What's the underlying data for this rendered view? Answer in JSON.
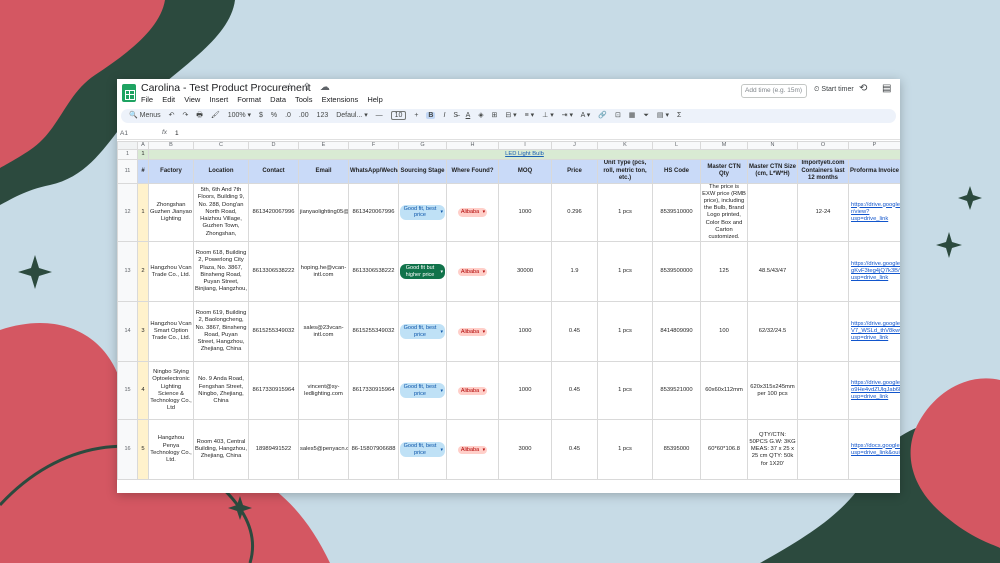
{
  "app": {
    "title": "Carolina - Test Product Procurement",
    "title_icons": "☆ ⇪ ☁",
    "menu": [
      "File",
      "Edit",
      "View",
      "Insert",
      "Format",
      "Data",
      "Tools",
      "Extensions",
      "Help"
    ],
    "time_placeholder": "Add time (e.g. 15m)",
    "start_timer": "⏲ Start timer"
  },
  "toolbar": {
    "menus_label": "🔍 Menus",
    "undo": "↶",
    "redo": "↷",
    "print": "🖶",
    "paint": "🖌",
    "zoom": "100% ▾",
    "currency": "$",
    "percent": "%",
    "dec_less": ".0",
    "dec_more": ".00",
    "num_format": "123",
    "font": "Defaul... ▾",
    "minus": "—",
    "font_size": "10",
    "plus": "+",
    "bold": "B",
    "italic": "I",
    "strike": "S̶",
    "text_color": "A",
    "fill": "◈",
    "borders": "⊞",
    "merge": "⊟ ▾",
    "align": "≡ ▾",
    "valign": "⊥ ▾",
    "wrap": "⇥ ▾",
    "rotate": "A ▾",
    "link": "🔗",
    "comment": "⊡",
    "chart": "▦",
    "filter": "⏷",
    "views": "▤ ▾",
    "functions": "Σ"
  },
  "formula": {
    "cell_ref": "A1",
    "fx": "fx",
    "value": "1"
  },
  "grid": {
    "columns": [
      "",
      "A",
      "B",
      "C",
      "D",
      "E",
      "F",
      "G",
      "H",
      "I",
      "J",
      "K",
      "L",
      "M",
      "N",
      "O",
      "P"
    ],
    "group_row": {
      "num": "1",
      "a": "1",
      "label": "LED Light Bulb"
    },
    "header": {
      "num": "11",
      "cells": [
        "#",
        "Factory",
        "Location",
        "Contact",
        "Email",
        "WhatsApp/Wechat",
        "Sourcing Stage",
        "Where Found?",
        "MOQ",
        "Price",
        "Unit Type (pcs, roll, metric ton, etc.)",
        "HS Code",
        "Master CTN Qty",
        "Master CTN Size (cm, L*W*H)",
        "Importyeti.com Containers last 12 months",
        "Proforma Invoice"
      ]
    },
    "rows": [
      {
        "num": "12",
        "id": "1",
        "factory": "Zhongshan Guzhen Jianyao Lighting",
        "location": "5th, 6th And 7th Floors, Building 9, No. 288, Dong'an North Road, Haizhou Village, Guzhen Town, Zhongshan,",
        "contact": "8613420067996",
        "email": "jianyaolighting05@outlook.com",
        "whatsapp": "8613420067996",
        "stage": "Good fit, best price",
        "found": "Alibaba",
        "moq": "1000",
        "price": "0.296",
        "unit": "1 pcs",
        "hs": "8539510000",
        "ctn_qty": "The price is EXW price (RMB price), including the Bulb, Brand Logo printed, Color Box and Carton customized.",
        "ctn_size": "",
        "containers": "12-24",
        "invoice": "https://drive.google.com/file/d/1e2uabPWXdv9mkJEBzdiWmlDgQUp1QU-r/view?usp=drive_link"
      },
      {
        "num": "13",
        "id": "2",
        "factory": "Hangzhou Vcan Trade Co., Ltd.",
        "location": "Room 618, Building 2, Powerlong City Plaza, No. 3867, Binsheng Road, Puyan Street, Binjiang, Hangzhou,",
        "contact": "8613306538222",
        "email": "hoping.he@vcan-intl.com",
        "whatsapp": "8613306538222",
        "stage": "Good fit but higher price",
        "found": "Alibaba",
        "moq": "30000",
        "price": "1.9",
        "unit": "1 pcs",
        "hs": "8539500000",
        "ctn_qty": "125",
        "ctn_size": "48.5/43/47",
        "containers": "",
        "invoice": "https://drive.google.com/file/d/1xpBW1Wy9edDeGatH-gKvF3teg4jQ7k3B/view?usp=drive_link"
      },
      {
        "num": "14",
        "id": "3",
        "factory": "Hangzhou Vcan Smart Option Trade Co., Ltd.",
        "location": "Room 619, Building 2, Baolongcheng, No. 3867, Binsheng Road, Puyan Street, Hangzhou, Zhejiang, China",
        "contact": "8615255349032",
        "email": "sales@23vcan-intl.com",
        "whatsapp": "8615255349032",
        "stage": "Good fit, best price",
        "found": "Alibaba",
        "moq": "1000",
        "price": "0.45",
        "unit": "1 pcs",
        "hs": "8414809090",
        "ctn_qty": "100",
        "ctn_size": "62/32/24.5",
        "containers": "",
        "invoice": "https://drive.google.com/file/d/1-V7_WSLd_thV8kw02Gbmw_i6lTvz9t12/view?usp=drive_link"
      },
      {
        "num": "15",
        "id": "4",
        "factory": "Ningbo Siying Optoelectronic Lighting Science & Technology Co., Ltd",
        "location": "No. 9 Anda Road, Fengshan Street, Ningbo, Zhejiang, China",
        "contact": "8617330915964",
        "email": "vincent@sy-ledlighting.com",
        "whatsapp": "8617330915964",
        "stage": "Good fit, best price",
        "found": "Alibaba",
        "moq": "1000",
        "price": "0.45",
        "unit": "1 pcs",
        "hs": "8539521000",
        "ctn_qty": "60x60x112mm",
        "ctn_size": "620x315x245mm per 100 pcs",
        "containers": "",
        "invoice": "https://drive.google.com/file/d/1Z-o9He4vdZUlqJab6EKnlcfumJFlxX/view?usp=drive_link"
      },
      {
        "num": "16",
        "id": "5",
        "factory": "Hangzhou Penya Technology Co., Ltd.",
        "location": "Room 403, Central Building, Hangzhou, Zhejiang, China",
        "contact": "18989491522",
        "email": "sales5@penyacn.com",
        "whatsapp": "86-15807906688",
        "stage": "Good fit, best price",
        "found": "Alibaba",
        "moq": "3000",
        "price": "0.45",
        "unit": "1 pcs",
        "hs": "85395000",
        "ctn_qty": "60*60*106.8",
        "ctn_size": "QTY/CTN: 50PCS G.W: 3KG MEAS: 37 x 25 x 25 cm QTY: 50k for 1X20'",
        "containers": "",
        "invoice": "https://docs.google.com/spreadsheets/d/1TZZvhF_HE968Qhv09liA8nwXcOL1nOUe/edit?usp=drive_link&ouid=11123407990049875"
      }
    ]
  },
  "colors": {
    "background": "#c7dbe6",
    "blob_red": "#d45762",
    "blob_green": "#2c4a3e",
    "header_fill": "#c9daf8",
    "group_fill": "#d9ead3",
    "chip_blue": "#bfe1f6",
    "chip_green": "#11734b",
    "chip_red": "#ffcfc9"
  }
}
